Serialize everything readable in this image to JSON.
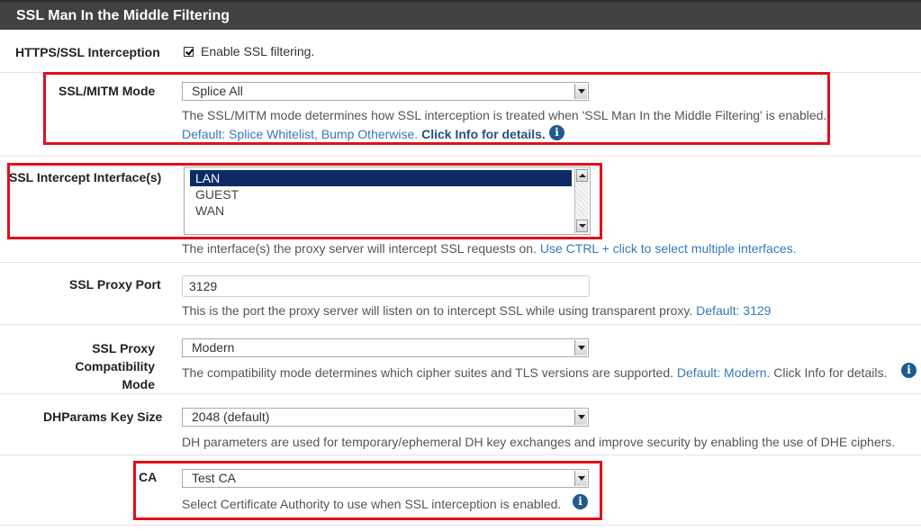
{
  "panel": {
    "title": "SSL Man In the Middle Filtering"
  },
  "https": {
    "label": "HTTPS/SSL Interception",
    "checkbox_label": "Enable SSL filtering."
  },
  "mitm": {
    "label": "SSL/MITM Mode",
    "value": "Splice All",
    "help": "The SSL/MITM mode determines how SSL interception is treated when 'SSL Man In the Middle Filtering' is enabled.",
    "default_text": "Default: Splice Whitelist, Bump Otherwise.",
    "info_text": "Click Info for details."
  },
  "iface": {
    "label": "SSL Intercept Interface(s)",
    "options": [
      "LAN",
      "GUEST",
      "WAN"
    ],
    "selected": "LAN",
    "help": "The interface(s) the proxy server will intercept SSL requests on.",
    "help_link": "Use CTRL + click to select multiple interfaces."
  },
  "port": {
    "label": "SSL Proxy Port",
    "value": "3129",
    "help": "This is the port the proxy server will listen on to intercept SSL while using transparent proxy.",
    "default_text": "Default: 3129"
  },
  "compat": {
    "label_line1": "SSL Proxy Compatibility",
    "label_line2": "Mode",
    "value": "Modern",
    "help": "The compatibility mode determines which cipher suites and TLS versions are supported.",
    "default_text": "Default: Modern.",
    "help_tail": "Click Info for details."
  },
  "dh": {
    "label": "DHParams Key Size",
    "value": "2048 (default)",
    "help": "DH parameters are used for temporary/ephemeral DH key exchanges and improve security by enabling the use of DHE ciphers."
  },
  "ca": {
    "label": "CA",
    "value": "Test CA",
    "help": "Select Certificate Authority to use when SSL interception is enabled."
  },
  "icons": {
    "info": "info-icon",
    "checkbox": "checkbox-checked-icon"
  },
  "colors": {
    "header": "#424242",
    "highlight_box": "#e0101a",
    "link": "#337ab7",
    "selected_option": "#0c2b66"
  }
}
